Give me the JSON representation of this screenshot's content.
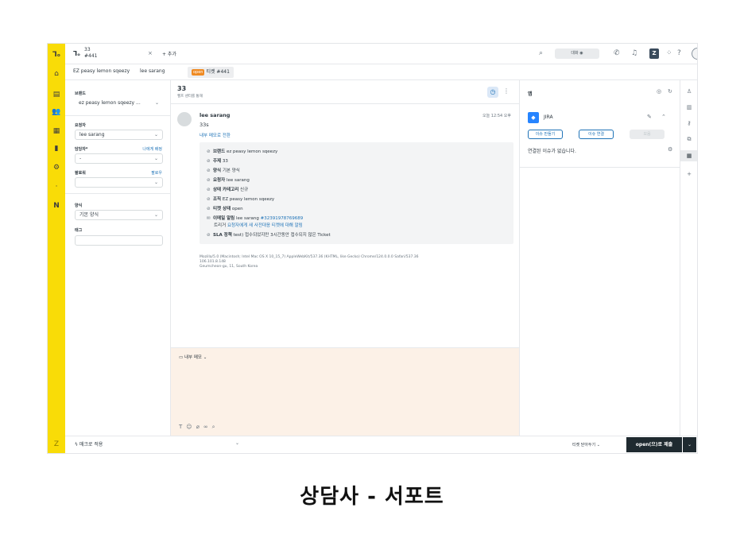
{
  "window": {
    "tab_title": "33",
    "tab_sub": "#441",
    "tab_close": "×",
    "add_tab": "+ 추가",
    "chat_label": "대화",
    "product_badge": "Z"
  },
  "breadcrumbs": {
    "org": "EZ peasy lemon sqeezy",
    "user": "lee sarang",
    "status": "open",
    "ticket": "티켓 #441"
  },
  "properties": {
    "brand_label": "브랜드",
    "brand_value": "ez peasy lemon sqeezy ...",
    "requester_label": "요청자",
    "requester_value": "lee sarang",
    "assignee_label": "담당자*",
    "assign_me": "나에게 배정",
    "assignee_value": "-",
    "cc_label": "팔로워",
    "follow": "팔로우",
    "form_label": "양식",
    "form_value": "기본 양식",
    "tags_label": "태그"
  },
  "conversation": {
    "title": "33",
    "subtitle": "헬프 센터를 통해",
    "author": "lee sarang",
    "time": "오늘 12:54 오후",
    "body": "33s",
    "internal_note_link": "내부 메모로 전환",
    "events": [
      {
        "key": "브랜드",
        "value": "ez peasy lemon sqeezy"
      },
      {
        "key": "주제",
        "value": "33"
      },
      {
        "key": "양식",
        "value": "기본 양식"
      },
      {
        "key": "요청자",
        "value": "lee sarang"
      },
      {
        "key": "상태 카테고리",
        "value": "신규"
      },
      {
        "key": "조직",
        "value": "EZ peasy lemon sqeezy"
      },
      {
        "key": "티켓 상태",
        "value": "open"
      }
    ],
    "email_key": "이메일 알림",
    "email_user": "lee sarang ",
    "email_id": "#32391978769689",
    "email_trigger_prefix": "트리거 ",
    "email_trigger": "요청자에게 새 사전대응 티켓에 대해 알림",
    "sla_key": "SLA 정책",
    "sla_value": "test) 접수되었지만 3시간동안 접수되지 않은 Ticket",
    "meta_ua": "Mozilla/5.0 (Macintosh; Intel Mac OS X 10_15_7) AppleWebKit/537.36 (KHTML, like Gecko) Chrome/124.0.0.0 Safari/537.36",
    "meta_ip": "106.101.8.148",
    "meta_loc": "Geumcheon-gu, 11, South Korea"
  },
  "composer": {
    "mode": "내부 메모"
  },
  "apps": {
    "title": "앱",
    "jira_name": "JIRA",
    "btn_create": "이슈 만들기",
    "btn_link": "이슈 연결",
    "btn_disabled": "모음",
    "empty": "연결된 이슈가 없습니다."
  },
  "footer": {
    "macro": "매크로 적용",
    "close_tab": "티켓 닫아두기",
    "submit": "open(으)로 제출"
  },
  "caption": "상담사 - 서포트",
  "colors": {
    "rail": "#f9dc07",
    "accent": "#1f73b7",
    "open_badge": "#ef8a22",
    "composer_bg": "#fcf1e7",
    "submit_bg": "#1f2a30"
  }
}
